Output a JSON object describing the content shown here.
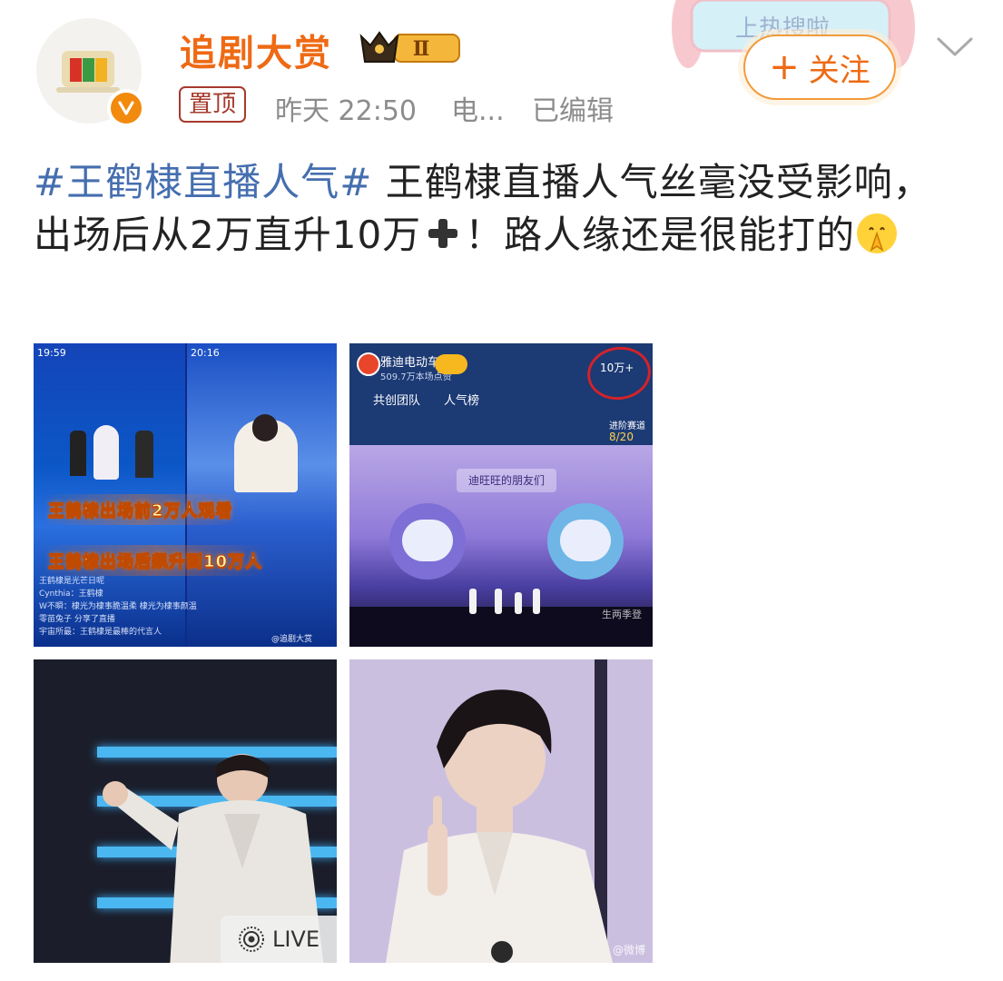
{
  "header": {
    "username": "追剧大赏",
    "vip_level": "Ⅱ",
    "pin_tag": "置顶",
    "time": "昨天 22:50",
    "source": "电...",
    "edited": "已编辑",
    "follow_label": "关注",
    "follow_plus": "+",
    "deco_text": "上热搜啦"
  },
  "post": {
    "hashtag": "#王鹤棣直播人气#",
    "text_before_emoji": " 王鹤棣直播人气丝毫没受影响，出场后从2万直升10万",
    "text_after_emoji": "！路人缘还是很能打的"
  },
  "images": [
    {
      "left_time": "19:59",
      "right_time": "20:16",
      "caption_top": "王鹤棣出场前2万人观看",
      "caption_bottom": "王鹤棣出场后飙升到10万人",
      "watermark": "@追剧大赏",
      "chat_lines": [
        "王鹤棣是光芒日呢",
        "Cynthia：王鹤棣",
        "W不瞬：棣光为棣事脆温柔 棣光为棣事颜温",
        "零苗兔子 分享了直播",
        "宇宙所最：王鹤棣是最棒的代言人"
      ]
    },
    {
      "stream_name": "雅迪电动车",
      "likes": "509.7万本场点赞",
      "viewers": "10万+",
      "team": "共创团队",
      "rank": "人气榜",
      "progress_label": "进阶赛道",
      "progress": "8/20",
      "banner": "迪旺旺的朋友们",
      "watermark": "生两季登"
    },
    {
      "live_label": "LIVE"
    },
    {
      "watermark": "@微博"
    }
  ],
  "colors": {
    "username": "#ee6a14",
    "hashtag": "#456eaf",
    "pin": "#a63a2d",
    "meta": "#8c8c8c",
    "follow_border": "#f39a3a"
  }
}
